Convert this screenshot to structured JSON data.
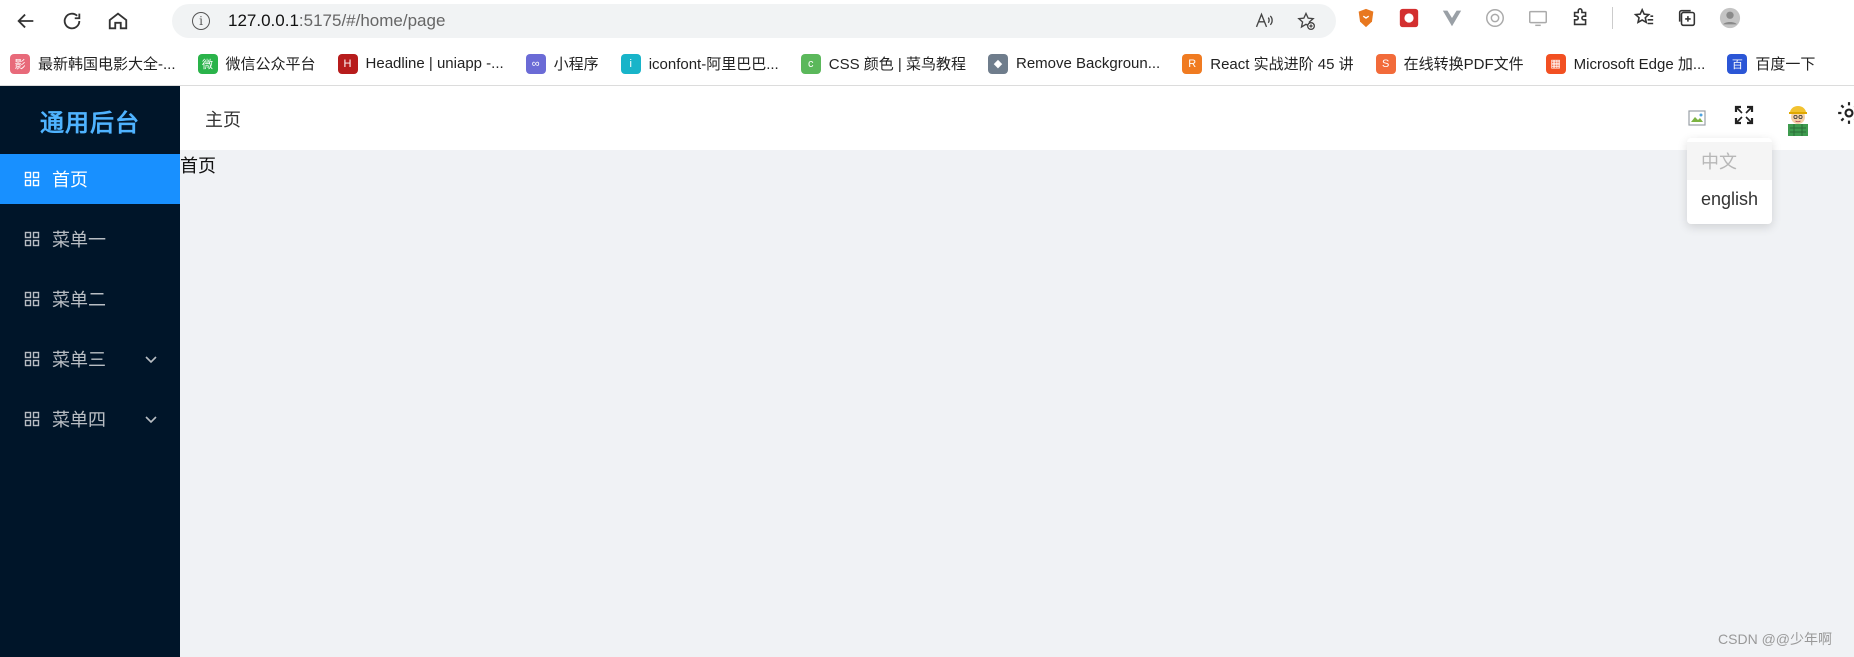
{
  "browser": {
    "url_host": "127.0.0.1",
    "url_rest": ":5175/#/home/page",
    "info_glyph": "i"
  },
  "bookmarks": [
    {
      "label": "最新韩国电影大全-...",
      "color": "#e86a7a",
      "glyph": "影"
    },
    {
      "label": "微信公众平台",
      "color": "#2ab34a",
      "glyph": "微"
    },
    {
      "label": "Headline | uniapp -...",
      "color": "#b71c1c",
      "glyph": "H"
    },
    {
      "label": "小程序",
      "color": "#6b6bd6",
      "glyph": "∞"
    },
    {
      "label": "iconfont-阿里巴巴...",
      "color": "#18b4c9",
      "glyph": "i"
    },
    {
      "label": "CSS 颜色 | 菜鸟教程",
      "color": "#5bb85b",
      "glyph": "c"
    },
    {
      "label": "Remove Backgroun...",
      "color": "#6f7d8c",
      "glyph": "◆"
    },
    {
      "label": "React 实战进阶 45 讲",
      "color": "#f07b21",
      "glyph": "R"
    },
    {
      "label": "在线转换PDF文件",
      "color": "#f26b3a",
      "glyph": "S"
    },
    {
      "label": "Microsoft Edge 加...",
      "color": "#f25022",
      "glyph": "▦"
    },
    {
      "label": "百度一下",
      "color": "#2b56d6",
      "glyph": "百"
    }
  ],
  "app": {
    "logo": "通用后台",
    "header_title": "主页",
    "content_text": "首页",
    "menu": [
      {
        "label": "首页",
        "active": true,
        "submenu": false
      },
      {
        "label": "菜单一",
        "active": false,
        "submenu": false
      },
      {
        "label": "菜单二",
        "active": false,
        "submenu": false
      },
      {
        "label": "菜单三",
        "active": false,
        "submenu": true
      },
      {
        "label": "菜单四",
        "active": false,
        "submenu": true
      }
    ],
    "language_dropdown": {
      "options": [
        "中文",
        "english"
      ],
      "selected": "中文"
    }
  },
  "watermark": "CSDN @@少年啊",
  "colors": {
    "sider_bg": "#001529",
    "accent": "#1890ff",
    "logo": "#4fb3ff",
    "content_bg": "#f0f2f5"
  }
}
